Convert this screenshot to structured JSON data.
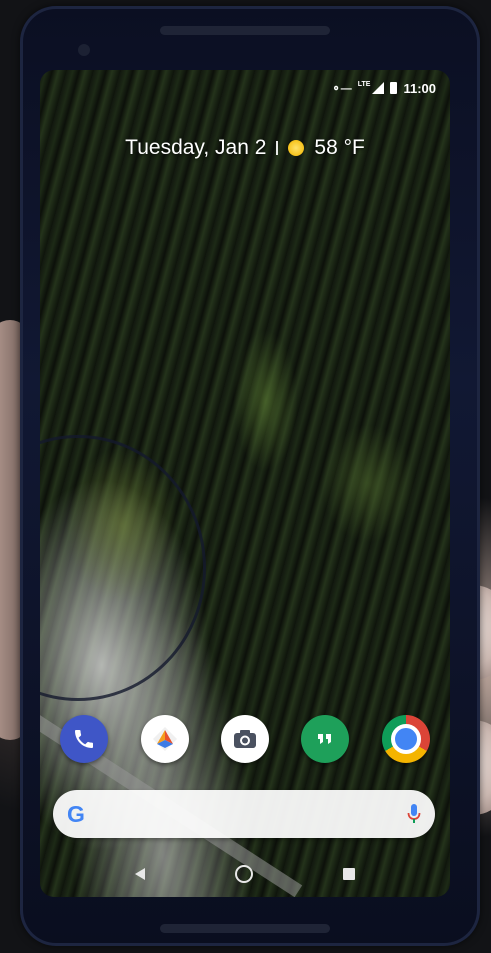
{
  "status_bar": {
    "network_label": "LTE",
    "time": "11:00"
  },
  "glance": {
    "date": "Tuesday, Jan 2",
    "temperature": "58 °F"
  },
  "dock": {
    "apps": [
      {
        "name": "Phone",
        "icon": "phone-icon"
      },
      {
        "name": "Maps",
        "icon": "maps-icon"
      },
      {
        "name": "Camera",
        "icon": "camera-icon"
      },
      {
        "name": "Hangouts",
        "icon": "hangouts-icon"
      },
      {
        "name": "Chrome",
        "icon": "chrome-icon"
      }
    ]
  },
  "search": {
    "logo": "G",
    "icons": [
      "google-g-icon",
      "mic-icon"
    ]
  },
  "navigation": {
    "buttons": [
      "back",
      "home",
      "recents"
    ]
  },
  "colors": {
    "phone_app": "#3f56c7",
    "hangouts_app": "#1ea05a",
    "chrome_blue": "#4285f4",
    "sun": "#f6c21a"
  }
}
